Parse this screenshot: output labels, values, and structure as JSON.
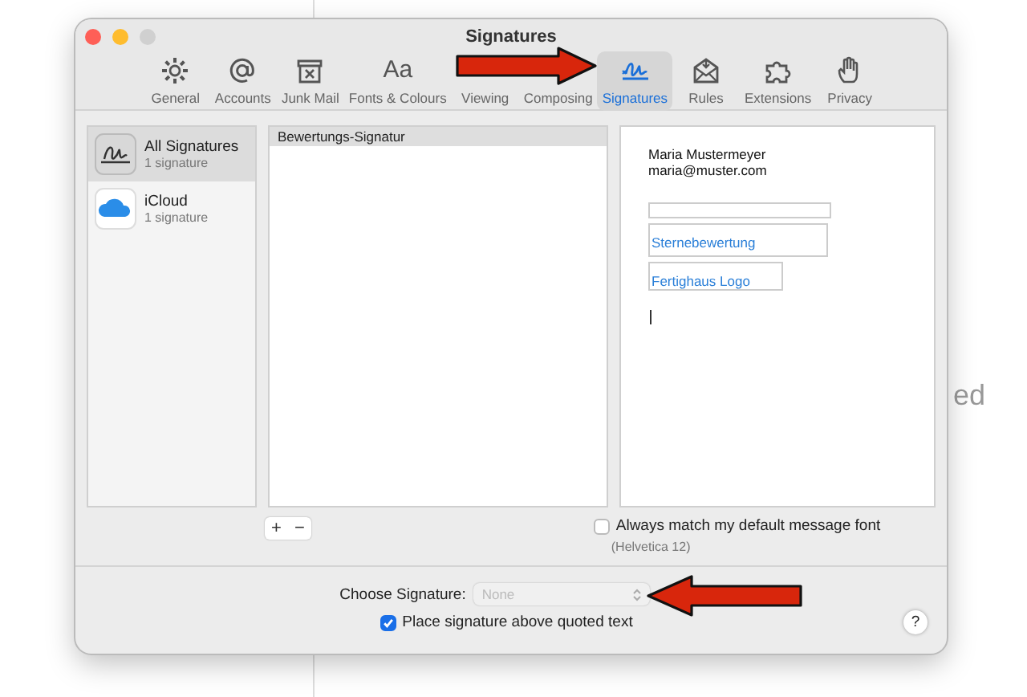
{
  "window": {
    "title": "Signatures"
  },
  "toolbar": [
    {
      "label": "General",
      "selected": false
    },
    {
      "label": "Accounts",
      "selected": false
    },
    {
      "label": "Junk Mail",
      "selected": false
    },
    {
      "label": "Fonts & Colours",
      "icon_text": "Aa",
      "selected": false
    },
    {
      "label": "Viewing",
      "selected": false
    },
    {
      "label": "Composing",
      "selected": false
    },
    {
      "label": "Signatures",
      "selected": true
    },
    {
      "label": "Rules",
      "selected": false
    },
    {
      "label": "Extensions",
      "selected": false
    },
    {
      "label": "Privacy",
      "selected": false
    }
  ],
  "accounts": [
    {
      "name": "All Signatures",
      "count": "1 signature",
      "selected": true
    },
    {
      "name": "iCloud",
      "count": "1 signature",
      "selected": false
    }
  ],
  "signatures": [
    {
      "name": "Bewertungs-Signatur",
      "selected": true
    }
  ],
  "preview": {
    "name": "Maria Mustermeyer",
    "email": "maria@muster.com",
    "fields": [
      "Sternebewertung",
      "Fertighaus Logo"
    ]
  },
  "list_buttons": [
    "+",
    "−"
  ],
  "match_font": {
    "label": "Always match my default message font",
    "checked": false,
    "note": "(Helvetica 12)"
  },
  "choose_signature": {
    "label": "Choose Signature:",
    "value": "None",
    "disabled": true
  },
  "place_above": {
    "label": "Place signature above quoted text",
    "checked": true
  },
  "help": "?",
  "background_text": "ed"
}
